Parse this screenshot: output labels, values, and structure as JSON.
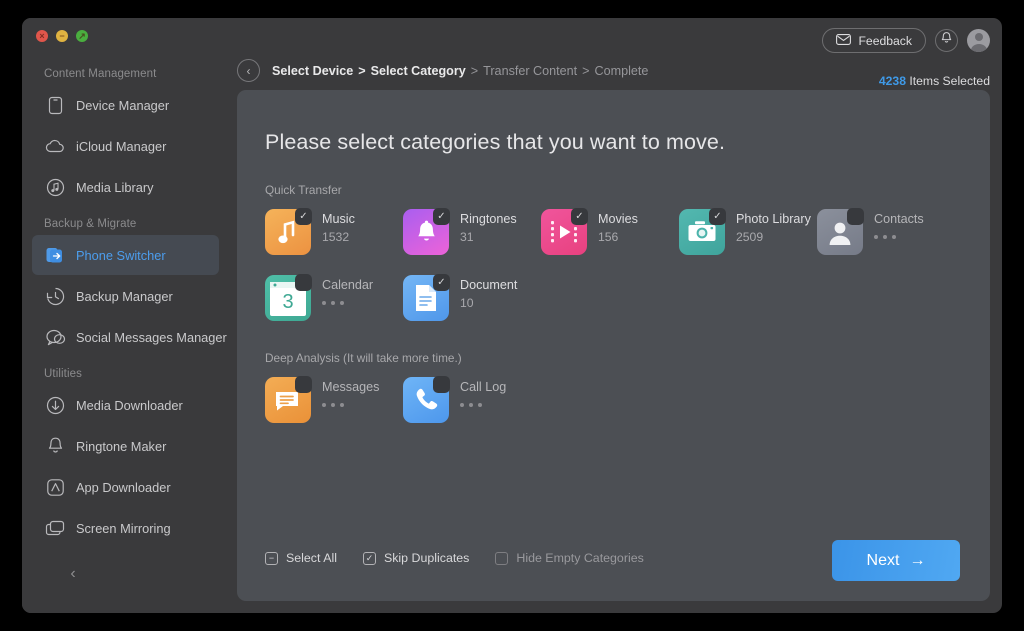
{
  "window": {
    "traffic_lights": [
      {
        "name": "close",
        "glyph": "×",
        "color": "#e0564b"
      },
      {
        "name": "minimize",
        "glyph": "−",
        "color": "#e0b341"
      },
      {
        "name": "maximize",
        "glyph": "↗",
        "color": "#4aae3f"
      }
    ]
  },
  "sidebar": {
    "sections": [
      {
        "label": "Content Management",
        "items": [
          {
            "label": "Device Manager",
            "icon": "phone-icon",
            "active": false
          },
          {
            "label": "iCloud Manager",
            "icon": "cloud-icon",
            "active": false
          },
          {
            "label": "Media Library",
            "icon": "music-note-icon",
            "active": false
          }
        ]
      },
      {
        "label": "Backup & Migrate",
        "items": [
          {
            "label": "Phone Switcher",
            "icon": "phone-switch-icon",
            "active": true
          },
          {
            "label": "Backup Manager",
            "icon": "clock-back-icon",
            "active": false
          },
          {
            "label": "Social Messages Manager",
            "icon": "chat-bubble-icon",
            "active": false
          }
        ]
      },
      {
        "label": "Utilities",
        "items": [
          {
            "label": "Media Downloader",
            "icon": "download-icon",
            "active": false
          },
          {
            "label": "Ringtone Maker",
            "icon": "bell-icon",
            "active": false
          },
          {
            "label": "App Downloader",
            "icon": "appstore-icon",
            "active": false
          },
          {
            "label": "Screen Mirroring",
            "icon": "screen-mirror-icon",
            "active": false
          }
        ]
      }
    ],
    "collapse_glyph": "‹"
  },
  "header": {
    "feedback_label": "Feedback",
    "feedback_icon": "envelope-icon",
    "bell_icon": "bell-icon",
    "avatar_icon": "user-avatar",
    "back_glyph": "‹",
    "breadcrumbs": [
      {
        "label": "Select Device",
        "active": true
      },
      {
        "label": "Select Category",
        "active": true
      },
      {
        "label": "Transfer Content",
        "active": false
      },
      {
        "label": "Complete",
        "active": false
      }
    ],
    "separator": ">",
    "items_selected_count": "4238",
    "items_selected_label": "Items Selected",
    "accent_color": "#3f9ae8"
  },
  "main": {
    "headline": "Please select categories that you want to move.",
    "groups": [
      {
        "label": "Quick Transfer",
        "rows": [
          [
            {
              "name": "Music",
              "count": "1532",
              "icon": "music-note-icon",
              "theme": "g-music",
              "checked": true,
              "loading": false,
              "enabled": true
            },
            {
              "name": "Ringtones",
              "count": "31",
              "icon": "bell-icon",
              "theme": "g-ring",
              "checked": true,
              "loading": false,
              "enabled": true
            },
            {
              "name": "Movies",
              "count": "156",
              "icon": "film-play-icon",
              "theme": "g-movie",
              "checked": true,
              "loading": false,
              "enabled": true
            },
            {
              "name": "Photo Library",
              "count": "2509",
              "icon": "camera-icon",
              "theme": "g-photo",
              "checked": true,
              "loading": false,
              "enabled": true
            },
            {
              "name": "Contacts",
              "count": "",
              "icon": "person-icon",
              "theme": "g-contact",
              "checked": false,
              "loading": true,
              "enabled": false
            }
          ],
          [
            {
              "name": "Calendar",
              "count": "",
              "icon": "calendar-icon",
              "theme": "g-calendar",
              "checked": false,
              "loading": true,
              "enabled": false
            },
            {
              "name": "Document",
              "count": "10",
              "icon": "document-icon",
              "theme": "g-doc",
              "checked": true,
              "loading": false,
              "enabled": true
            }
          ]
        ]
      },
      {
        "label": "Deep Analysis (It will take more time.)",
        "rows": [
          [
            {
              "name": "Messages",
              "count": "",
              "icon": "message-icon",
              "theme": "g-msg",
              "checked": false,
              "loading": true,
              "enabled": false
            },
            {
              "name": "Call Log",
              "count": "",
              "icon": "phone-call-icon",
              "theme": "g-call",
              "checked": false,
              "loading": true,
              "enabled": false
            }
          ]
        ]
      }
    ],
    "calendar_day": "3"
  },
  "footer": {
    "checkboxes": [
      {
        "label": "Select All",
        "state": "indeterminate",
        "glyph": "−",
        "dim": false
      },
      {
        "label": "Skip Duplicates",
        "state": "checked",
        "glyph": "✓",
        "dim": false
      },
      {
        "label": "Hide Empty Categories",
        "state": "unchecked",
        "glyph": "",
        "dim": true
      }
    ],
    "next_label": "Next",
    "next_arrow": "→"
  }
}
